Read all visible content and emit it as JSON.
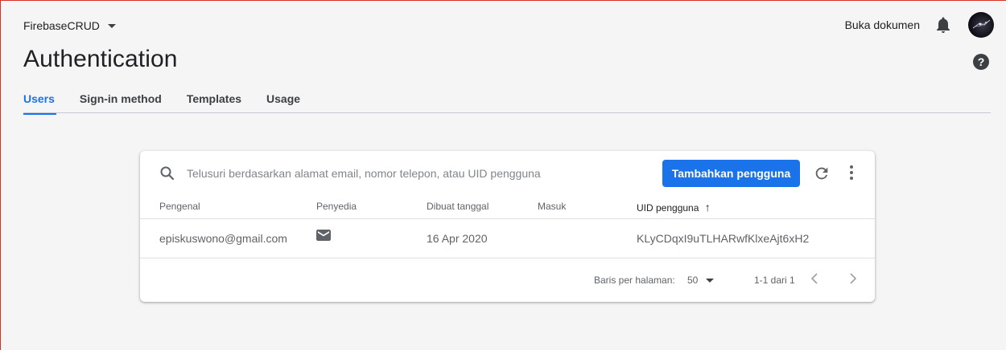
{
  "header": {
    "project": "FirebaseCRUD",
    "doc_link": "Buka dokumen",
    "title": "Authentication"
  },
  "tabs": [
    {
      "label": "Users",
      "active": true
    },
    {
      "label": "Sign-in method",
      "active": false
    },
    {
      "label": "Templates",
      "active": false
    },
    {
      "label": "Usage",
      "active": false
    }
  ],
  "search": {
    "placeholder": "Telusuri berdasarkan alamat email, nomor telepon, atau UID pengguna",
    "value": ""
  },
  "toolbar": {
    "add_user_label": "Tambahkan pengguna"
  },
  "table": {
    "columns": [
      "Pengenal",
      "Penyedia",
      "Dibuat tanggal",
      "Masuk",
      "UID pengguna"
    ],
    "sort_indicator": "↑",
    "rows": [
      {
        "identifier": "episkuswono@gmail.com",
        "provider_icon": "email-icon",
        "created": "16 Apr 2020",
        "signed_in": "",
        "uid": "KLyCDqxI9uTLHARwfKlxeAjt6xH2"
      }
    ]
  },
  "pagination": {
    "rows_per_page_label": "Baris per halaman:",
    "rows_per_page": "50",
    "range": "1-1 dari 1"
  },
  "colors": {
    "accent": "#1a73e8",
    "text": "#202124",
    "muted": "#5f6368",
    "background": "#f5f5f5"
  }
}
